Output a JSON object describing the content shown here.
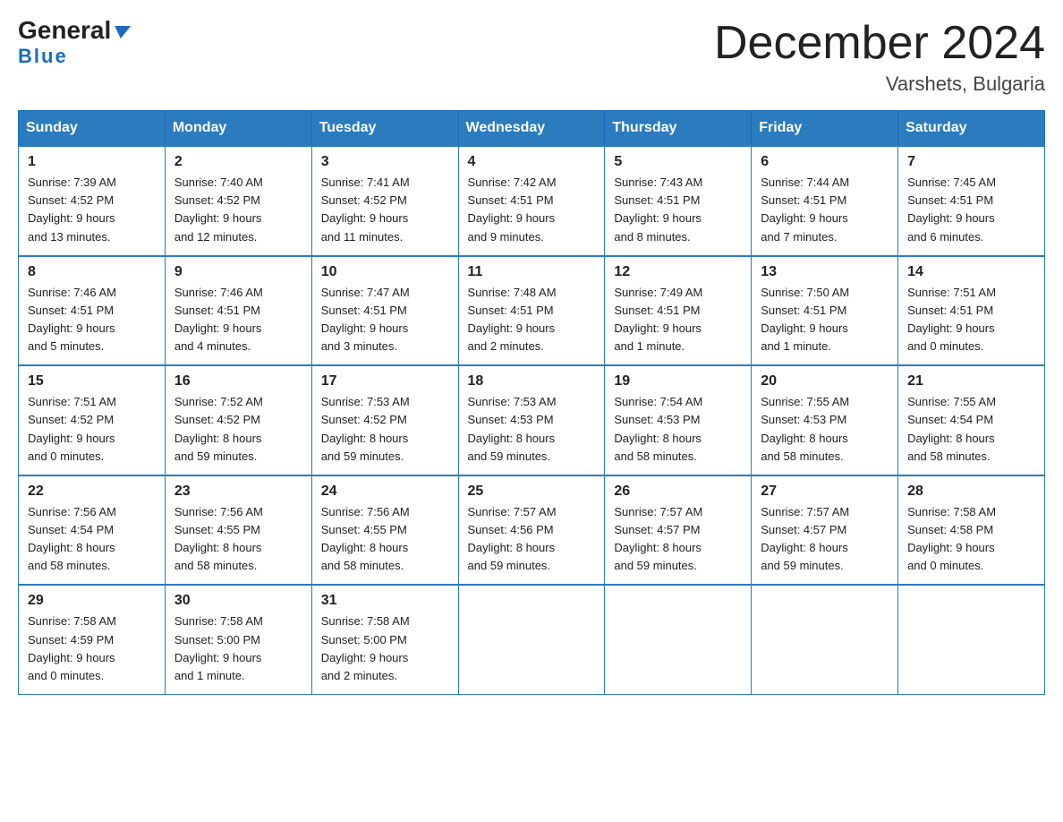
{
  "header": {
    "logo_general": "General",
    "logo_blue": "Blue",
    "title": "December 2024",
    "subtitle": "Varshets, Bulgaria"
  },
  "days_of_week": [
    "Sunday",
    "Monday",
    "Tuesday",
    "Wednesday",
    "Thursday",
    "Friday",
    "Saturday"
  ],
  "weeks": [
    [
      {
        "day": "1",
        "sunrise": "7:39 AM",
        "sunset": "4:52 PM",
        "daylight": "9 hours and 13 minutes."
      },
      {
        "day": "2",
        "sunrise": "7:40 AM",
        "sunset": "4:52 PM",
        "daylight": "9 hours and 12 minutes."
      },
      {
        "day": "3",
        "sunrise": "7:41 AM",
        "sunset": "4:52 PM",
        "daylight": "9 hours and 11 minutes."
      },
      {
        "day": "4",
        "sunrise": "7:42 AM",
        "sunset": "4:51 PM",
        "daylight": "9 hours and 9 minutes."
      },
      {
        "day": "5",
        "sunrise": "7:43 AM",
        "sunset": "4:51 PM",
        "daylight": "9 hours and 8 minutes."
      },
      {
        "day": "6",
        "sunrise": "7:44 AM",
        "sunset": "4:51 PM",
        "daylight": "9 hours and 7 minutes."
      },
      {
        "day": "7",
        "sunrise": "7:45 AM",
        "sunset": "4:51 PM",
        "daylight": "9 hours and 6 minutes."
      }
    ],
    [
      {
        "day": "8",
        "sunrise": "7:46 AM",
        "sunset": "4:51 PM",
        "daylight": "9 hours and 5 minutes."
      },
      {
        "day": "9",
        "sunrise": "7:46 AM",
        "sunset": "4:51 PM",
        "daylight": "9 hours and 4 minutes."
      },
      {
        "day": "10",
        "sunrise": "7:47 AM",
        "sunset": "4:51 PM",
        "daylight": "9 hours and 3 minutes."
      },
      {
        "day": "11",
        "sunrise": "7:48 AM",
        "sunset": "4:51 PM",
        "daylight": "9 hours and 2 minutes."
      },
      {
        "day": "12",
        "sunrise": "7:49 AM",
        "sunset": "4:51 PM",
        "daylight": "9 hours and 1 minute."
      },
      {
        "day": "13",
        "sunrise": "7:50 AM",
        "sunset": "4:51 PM",
        "daylight": "9 hours and 1 minute."
      },
      {
        "day": "14",
        "sunrise": "7:51 AM",
        "sunset": "4:51 PM",
        "daylight": "9 hours and 0 minutes."
      }
    ],
    [
      {
        "day": "15",
        "sunrise": "7:51 AM",
        "sunset": "4:52 PM",
        "daylight": "9 hours and 0 minutes."
      },
      {
        "day": "16",
        "sunrise": "7:52 AM",
        "sunset": "4:52 PM",
        "daylight": "8 hours and 59 minutes."
      },
      {
        "day": "17",
        "sunrise": "7:53 AM",
        "sunset": "4:52 PM",
        "daylight": "8 hours and 59 minutes."
      },
      {
        "day": "18",
        "sunrise": "7:53 AM",
        "sunset": "4:53 PM",
        "daylight": "8 hours and 59 minutes."
      },
      {
        "day": "19",
        "sunrise": "7:54 AM",
        "sunset": "4:53 PM",
        "daylight": "8 hours and 58 minutes."
      },
      {
        "day": "20",
        "sunrise": "7:55 AM",
        "sunset": "4:53 PM",
        "daylight": "8 hours and 58 minutes."
      },
      {
        "day": "21",
        "sunrise": "7:55 AM",
        "sunset": "4:54 PM",
        "daylight": "8 hours and 58 minutes."
      }
    ],
    [
      {
        "day": "22",
        "sunrise": "7:56 AM",
        "sunset": "4:54 PM",
        "daylight": "8 hours and 58 minutes."
      },
      {
        "day": "23",
        "sunrise": "7:56 AM",
        "sunset": "4:55 PM",
        "daylight": "8 hours and 58 minutes."
      },
      {
        "day": "24",
        "sunrise": "7:56 AM",
        "sunset": "4:55 PM",
        "daylight": "8 hours and 58 minutes."
      },
      {
        "day": "25",
        "sunrise": "7:57 AM",
        "sunset": "4:56 PM",
        "daylight": "8 hours and 59 minutes."
      },
      {
        "day": "26",
        "sunrise": "7:57 AM",
        "sunset": "4:57 PM",
        "daylight": "8 hours and 59 minutes."
      },
      {
        "day": "27",
        "sunrise": "7:57 AM",
        "sunset": "4:57 PM",
        "daylight": "8 hours and 59 minutes."
      },
      {
        "day": "28",
        "sunrise": "7:58 AM",
        "sunset": "4:58 PM",
        "daylight": "9 hours and 0 minutes."
      }
    ],
    [
      {
        "day": "29",
        "sunrise": "7:58 AM",
        "sunset": "4:59 PM",
        "daylight": "9 hours and 0 minutes."
      },
      {
        "day": "30",
        "sunrise": "7:58 AM",
        "sunset": "5:00 PM",
        "daylight": "9 hours and 1 minute."
      },
      {
        "day": "31",
        "sunrise": "7:58 AM",
        "sunset": "5:00 PM",
        "daylight": "9 hours and 2 minutes."
      },
      null,
      null,
      null,
      null
    ]
  ],
  "labels": {
    "sunrise": "Sunrise:",
    "sunset": "Sunset:",
    "daylight": "Daylight:"
  }
}
